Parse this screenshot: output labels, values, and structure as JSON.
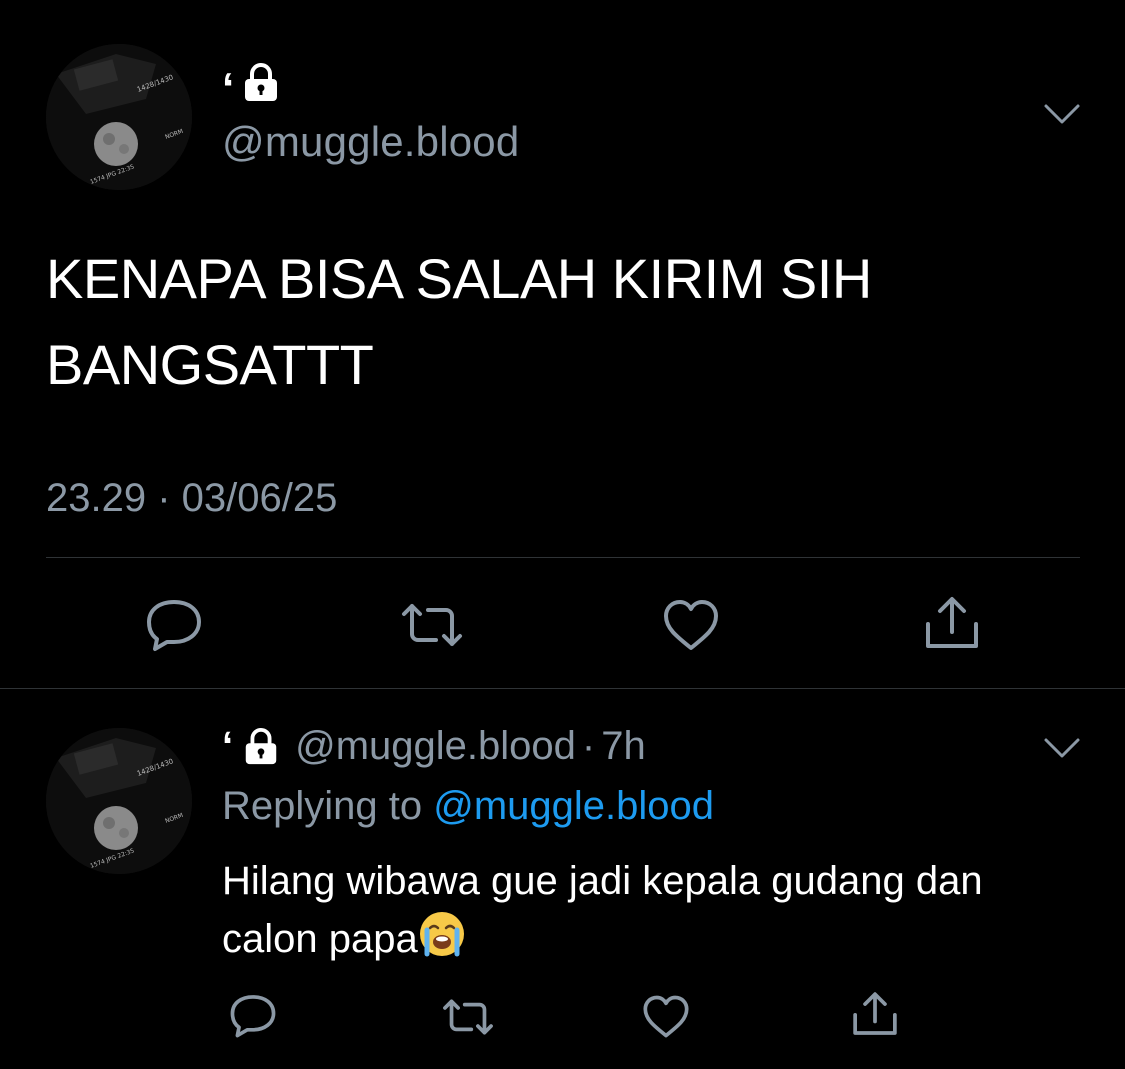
{
  "colors": {
    "background": "#000000",
    "text_primary": "#ffffff",
    "text_secondary": "#8b98a5",
    "link": "#1d9bf0",
    "divider": "#2f3336"
  },
  "main_tweet": {
    "display_name": "‘",
    "lock_icon": "lock-icon",
    "handle": "@muggle.blood",
    "text": "KENAPA BISA SALAH KIRIM SIH BANGSATTT",
    "timestamp": "23.29 · 03/06/25",
    "actions": [
      "reply-icon",
      "retweet-icon",
      "like-icon",
      "share-icon"
    ]
  },
  "reply_tweet": {
    "display_name": "‘",
    "lock_icon": "lock-icon",
    "handle": "@muggle.blood",
    "separator": "·",
    "time_ago": "7h",
    "replying_label": "Replying to",
    "replying_to": "@muggle.blood",
    "text": "Hilang wibawa gue jadi kepala gudang dan calon papa",
    "emoji": "loudly-crying-face-emoji",
    "actions": [
      "reply-icon",
      "retweet-icon",
      "like-icon",
      "share-icon"
    ]
  }
}
